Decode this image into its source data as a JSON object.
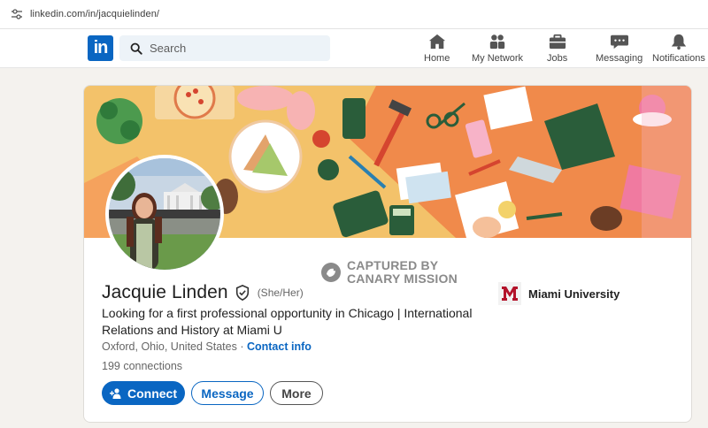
{
  "browser": {
    "url": "linkedin.com/in/jacquielinden/"
  },
  "header": {
    "logo_text": "in",
    "search_placeholder": "Search",
    "nav_items": [
      {
        "label": "Home",
        "icon": "home-icon"
      },
      {
        "label": "My Network",
        "icon": "network-icon"
      },
      {
        "label": "Jobs",
        "icon": "briefcase-icon"
      },
      {
        "label": "Messaging",
        "icon": "chat-icon"
      },
      {
        "label": "Notifications",
        "icon": "bell-icon"
      }
    ]
  },
  "profile": {
    "name": "Jacquie Linden",
    "pronouns": "(She/Her)",
    "headline": "Looking for a first professional opportunity in Chicago | International Relations and History at Miami U",
    "location": "Oxford, Ohio, United States",
    "separator": " · ",
    "contact_label": "Contact info",
    "connections": "199 connections",
    "school": "Miami University",
    "school_logo_letter": "M"
  },
  "actions": {
    "connect_label": "Connect",
    "message_label": "Message",
    "more_label": "More"
  },
  "watermark": {
    "line1": "CAPTURED BY",
    "line2": "CANARY MISSION"
  },
  "colors": {
    "brand_blue": "#0a66c2",
    "school_red": "#b3132b",
    "banner_bg": "#f3c26a"
  }
}
